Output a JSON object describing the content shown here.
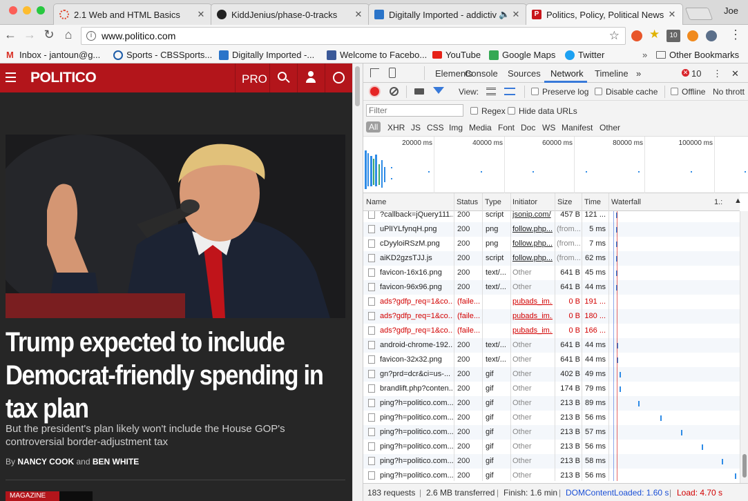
{
  "browser": {
    "tabs": [
      {
        "title": "2.1 Web and HTML Basics",
        "favicon_color": "#e0472e"
      },
      {
        "title": "KiddJenius/phase-0-tracks",
        "favicon_color": "#222222"
      },
      {
        "title": "Digitally Imported - addictiv",
        "favicon_color": "#2a74c9"
      },
      {
        "title": "Politics, Policy, Political News",
        "favicon_color": "#c8151b"
      }
    ],
    "profile_name": "Joe",
    "url": "www.politico.com",
    "notification_count": "10"
  },
  "bookmarks": [
    {
      "label": "Inbox - jantoun@g...",
      "icon": "gmail-icon",
      "color": "#d93025"
    },
    {
      "label": "Sports - CBSSports...",
      "icon": "cbs-icon",
      "color": "#1d5ca8"
    },
    {
      "label": "Digitally Imported -...",
      "icon": "di-icon",
      "color": "#2a74c9"
    },
    {
      "label": "Welcome to Facebo...",
      "icon": "facebook-icon",
      "color": "#3b5998"
    },
    {
      "label": "YouTube",
      "icon": "youtube-icon",
      "color": "#e62117"
    },
    {
      "label": "Google Maps",
      "icon": "maps-icon",
      "color": "#34a853"
    },
    {
      "label": "Twitter",
      "icon": "twitter-icon",
      "color": "#1da1f2"
    }
  ],
  "other_bookmarks": "Other Bookmarks",
  "page": {
    "brand": "POLITICO",
    "pro_label": "PRO",
    "headline": "Trump expected to include Democrat-friendly spending in tax plan",
    "dek": "But the president's plan likely won't include the House GOP's controversial border-adjustment tax",
    "byline_prefix": "By",
    "author1": "NANCY COOK",
    "byline_and": "and",
    "author2": "BEN WHITE",
    "section_badge": "MAGAZINE"
  },
  "devtools": {
    "tabs": [
      "Elements",
      "Console",
      "Sources",
      "Network",
      "Timeline"
    ],
    "active_tab": "Network",
    "error_count": "10",
    "view_label": "View:",
    "preserve_log": "Preserve log",
    "disable_cache": "Disable cache",
    "offline": "Offline",
    "throttle": "No thrott",
    "filter_placeholder": "Filter",
    "regex": "Regex",
    "hide_data_urls": "Hide data URLs",
    "type_filters": [
      "All",
      "XHR",
      "JS",
      "CSS",
      "Img",
      "Media",
      "Font",
      "Doc",
      "WS",
      "Manifest",
      "Other"
    ],
    "timeline_ticks": [
      "20000 ms",
      "40000 ms",
      "60000 ms",
      "80000 ms",
      "100000 ms"
    ],
    "columns": [
      "Name",
      "Status",
      "Type",
      "Initiator",
      "Size",
      "Time",
      "Waterfall"
    ],
    "waterfall_scale": "1.:",
    "requests": [
      {
        "name": "?callback=jQuery111...",
        "status": "200",
        "type": "script",
        "initiator": "jsonip.com/",
        "size": "457 B",
        "time": "121 ...",
        "failed": false,
        "link": true,
        "wf": 0.02
      },
      {
        "name": "uPlIYLfynqH.png",
        "status": "200",
        "type": "png",
        "initiator": "follow.php...",
        "size": "(from...",
        "time": "5 ms",
        "failed": false,
        "link": true,
        "wf": 0.02
      },
      {
        "name": "cDyyloiRSzM.png",
        "status": "200",
        "type": "png",
        "initiator": "follow.php...",
        "size": "(from...",
        "time": "7 ms",
        "failed": false,
        "link": true,
        "wf": 0.02
      },
      {
        "name": "aiKD2gzsTJJ.js",
        "status": "200",
        "type": "script",
        "initiator": "follow.php...",
        "size": "(from...",
        "time": "62 ms",
        "failed": false,
        "link": true,
        "wf": 0.02
      },
      {
        "name": "favicon-16x16.png",
        "status": "200",
        "type": "text/...",
        "initiator": "Other",
        "size": "641 B",
        "time": "45 ms",
        "failed": false,
        "link": false,
        "wf": 0.02
      },
      {
        "name": "favicon-96x96.png",
        "status": "200",
        "type": "text/...",
        "initiator": "Other",
        "size": "641 B",
        "time": "44 ms",
        "failed": false,
        "link": false,
        "wf": 0.02
      },
      {
        "name": "ads?gdfp_req=1&co...",
        "status": "(faile...",
        "type": "",
        "initiator": "pubads_im...",
        "size": "0 B",
        "time": "191 ...",
        "failed": true,
        "link": true,
        "wf": null
      },
      {
        "name": "ads?gdfp_req=1&co...",
        "status": "(faile...",
        "type": "",
        "initiator": "pubads_im...",
        "size": "0 B",
        "time": "180 ...",
        "failed": true,
        "link": true,
        "wf": null
      },
      {
        "name": "ads?gdfp_req=1&co...",
        "status": "(faile...",
        "type": "",
        "initiator": "pubads_im...",
        "size": "0 B",
        "time": "166 ...",
        "failed": true,
        "link": true,
        "wf": null
      },
      {
        "name": "android-chrome-192...",
        "status": "200",
        "type": "text/...",
        "initiator": "Other",
        "size": "641 B",
        "time": "44 ms",
        "failed": false,
        "link": false,
        "wf": 0.03
      },
      {
        "name": "favicon-32x32.png",
        "status": "200",
        "type": "text/...",
        "initiator": "Other",
        "size": "641 B",
        "time": "44 ms",
        "failed": false,
        "link": false,
        "wf": 0.03
      },
      {
        "name": "gn?prd=dcr&ci=us-...",
        "status": "200",
        "type": "gif",
        "initiator": "Other",
        "size": "402 B",
        "time": "49 ms",
        "failed": false,
        "link": false,
        "wf": 0.05
      },
      {
        "name": "brandlift.php?conten...",
        "status": "200",
        "type": "gif",
        "initiator": "Other",
        "size": "174 B",
        "time": "79 ms",
        "failed": false,
        "link": false,
        "wf": 0.05
      },
      {
        "name": "ping?h=politico.com...",
        "status": "200",
        "type": "gif",
        "initiator": "Other",
        "size": "213 B",
        "time": "89 ms",
        "failed": false,
        "link": false,
        "wf": 0.2
      },
      {
        "name": "ping?h=politico.com...",
        "status": "200",
        "type": "gif",
        "initiator": "Other",
        "size": "213 B",
        "time": "56 ms",
        "failed": false,
        "link": false,
        "wf": 0.38
      },
      {
        "name": "ping?h=politico.com...",
        "status": "200",
        "type": "gif",
        "initiator": "Other",
        "size": "213 B",
        "time": "57 ms",
        "failed": false,
        "link": false,
        "wf": 0.55
      },
      {
        "name": "ping?h=politico.com...",
        "status": "200",
        "type": "gif",
        "initiator": "Other",
        "size": "213 B",
        "time": "56 ms",
        "failed": false,
        "link": false,
        "wf": 0.72
      },
      {
        "name": "ping?h=politico.com...",
        "status": "200",
        "type": "gif",
        "initiator": "Other",
        "size": "213 B",
        "time": "58 ms",
        "failed": false,
        "link": false,
        "wf": 0.88
      },
      {
        "name": "ping?h=politico.com...",
        "status": "200",
        "type": "gif",
        "initiator": "Other",
        "size": "213 B",
        "time": "56 ms",
        "failed": false,
        "link": false,
        "wf": 0.99
      }
    ],
    "summary": {
      "requests": "183 requests",
      "transferred": "2.6 MB transferred",
      "finish": "Finish: 1.6 min",
      "dom": "DOMContentLoaded: 1.60 s",
      "load": "Load: 4.70 s"
    }
  },
  "colors": {
    "brand_red": "#b3151b",
    "devtools_accent": "#3879d9",
    "error_red": "#d20000",
    "dom_blue": "#1a4fd6"
  }
}
